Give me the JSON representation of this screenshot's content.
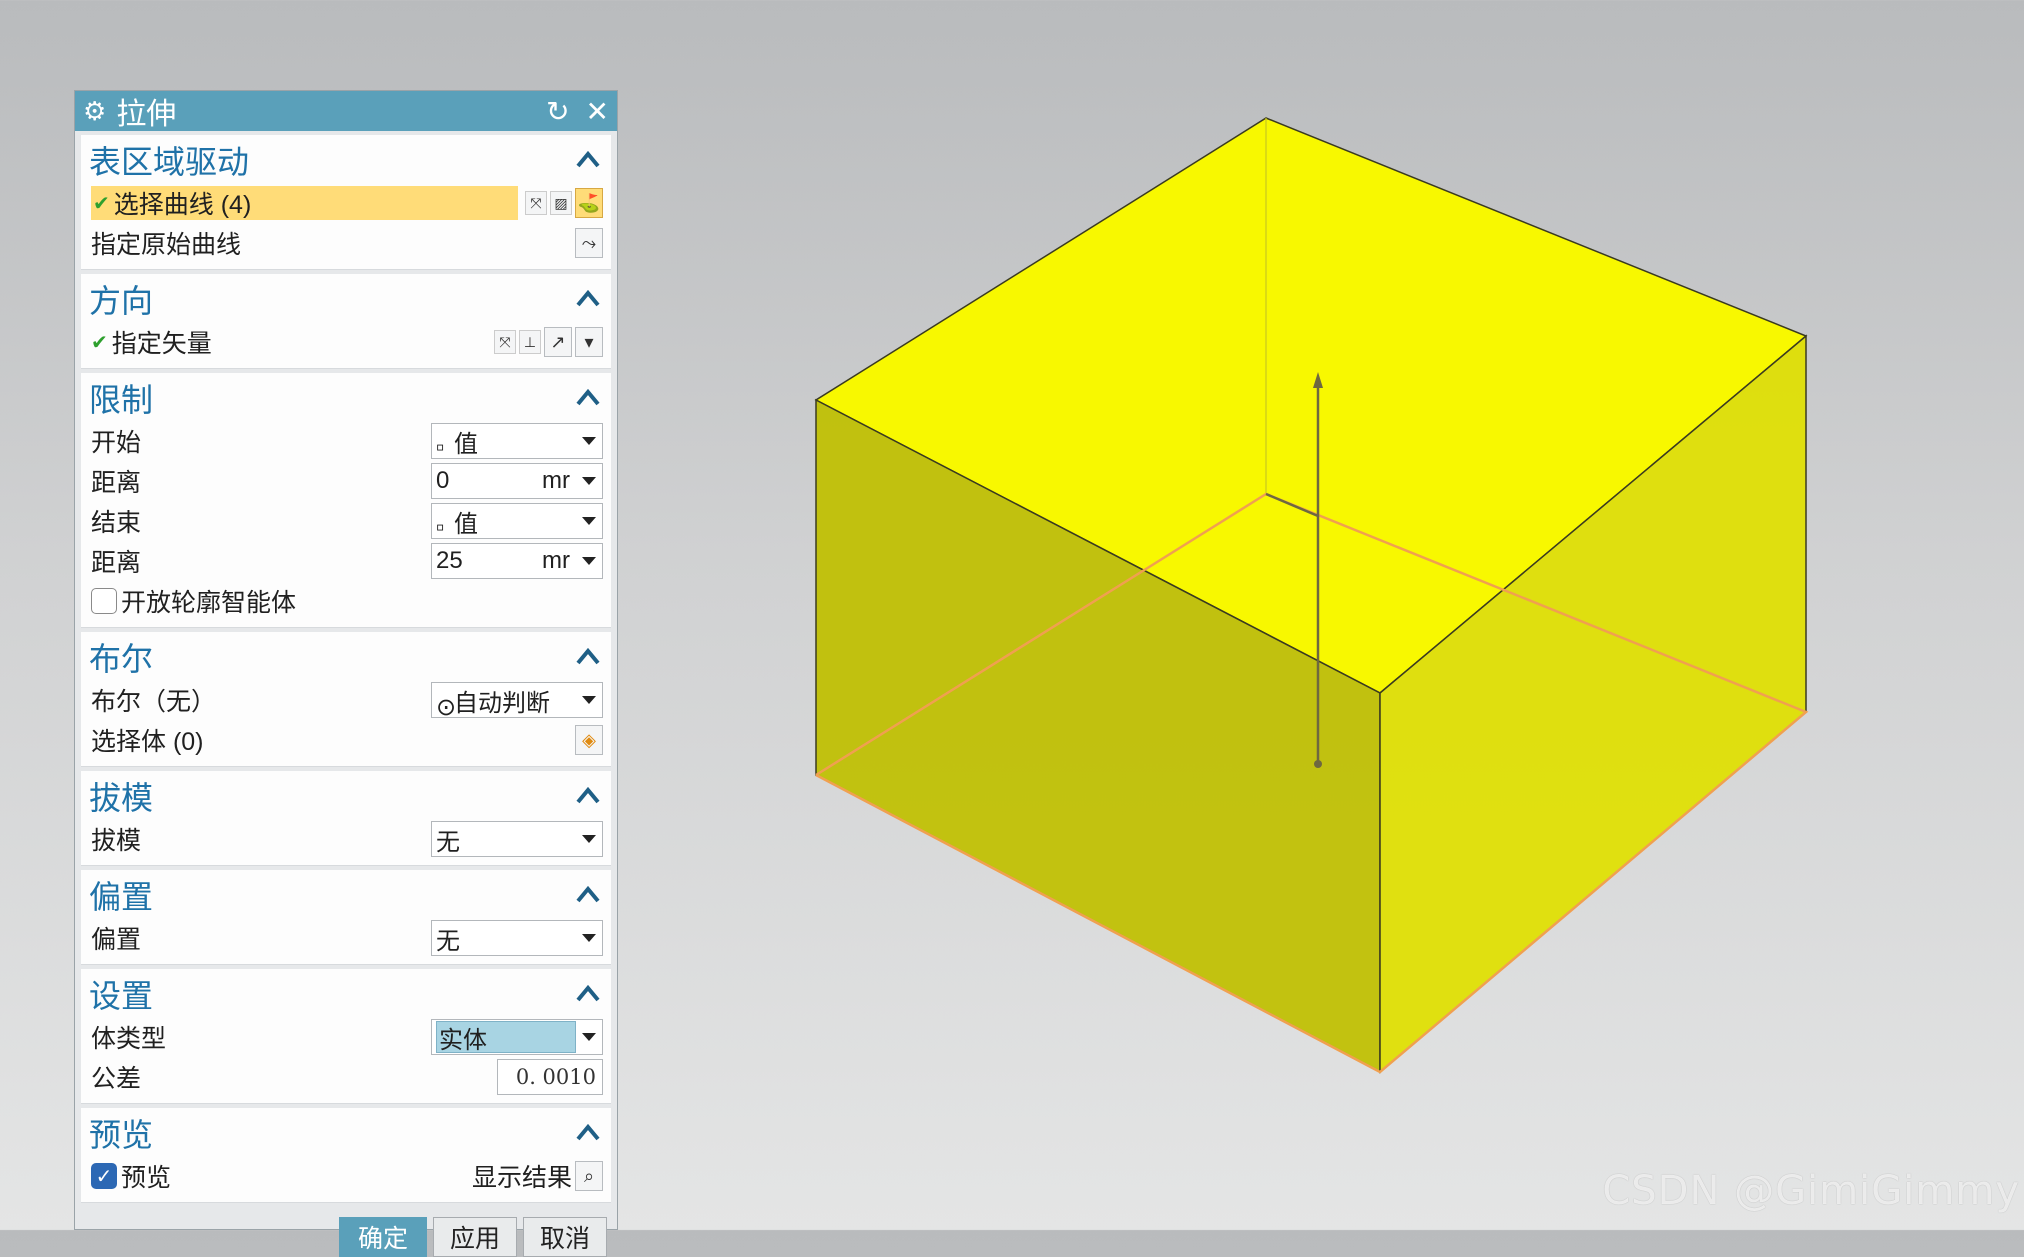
{
  "dialog": {
    "title": "拉伸",
    "sections": {
      "region": {
        "title": "表区域驱动",
        "select_curve": "选择曲线 (4)",
        "specify_original_curve": "指定原始曲线"
      },
      "direction": {
        "title": "方向",
        "specify_vector": "指定矢量"
      },
      "limits": {
        "title": "限制",
        "start_label": "开始",
        "start_value": "值",
        "distance1_label": "距离",
        "distance1_value": "0",
        "distance1_unit": "mr",
        "end_label": "结束",
        "end_value": "值",
        "distance2_label": "距离",
        "distance2_value": "25",
        "distance2_unit": "mr",
        "open_profile": "开放轮廓智能体",
        "open_profile_checked": false
      },
      "boolean": {
        "title": "布尔",
        "boolean_label": "布尔（无）",
        "boolean_value": "自动判断",
        "select_body": "选择体 (0)"
      },
      "draft": {
        "title": "拔模",
        "draft_label": "拔模",
        "draft_value": "无"
      },
      "offset": {
        "title": "偏置",
        "offset_label": "偏置",
        "offset_value": "无"
      },
      "settings": {
        "title": "设置",
        "body_type_label": "体类型",
        "body_type_value": "实体",
        "tolerance_label": "公差",
        "tolerance_value": "0. 0010"
      },
      "preview": {
        "title": "预览",
        "preview_label": "预览",
        "preview_checked": true,
        "show_result": "显示结果"
      }
    },
    "buttons": {
      "ok": "确定",
      "apply": "应用",
      "cancel": "取消"
    }
  },
  "viewport": {
    "solid_color": "#f5f500",
    "edge_highlight_color": "#f0a050"
  },
  "watermark": "CSDN @GimiGimmy",
  "colors": {
    "title_bar": "#5aa0ba",
    "section_title": "#1f72a8",
    "selection_highlight": "#ffdc78"
  }
}
